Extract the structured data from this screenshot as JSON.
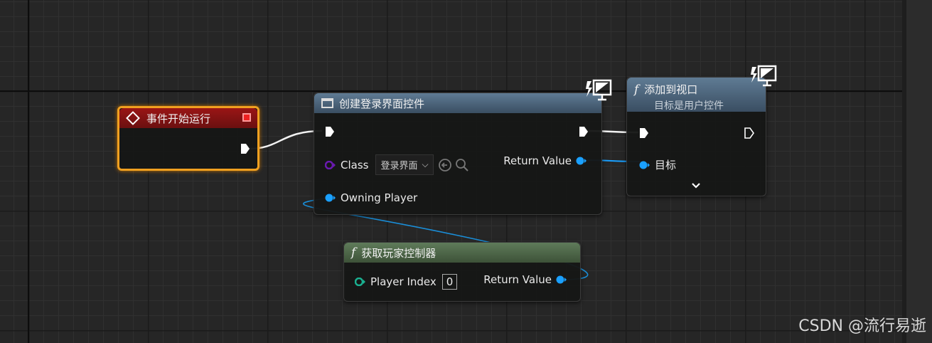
{
  "nodes": {
    "event_begin": {
      "title": "事件开始运行"
    },
    "create_widget": {
      "title": "创建登录界面控件",
      "class_label": "Class",
      "class_value": "登录界面",
      "owning_player_label": "Owning Player",
      "return_value_label": "Return Value"
    },
    "add_to_viewport": {
      "title": "添加到视口",
      "subtitle": "目标是用户控件",
      "target_label": "目标"
    },
    "get_player_controller": {
      "title": "获取玩家控制器",
      "player_index_label": "Player Index",
      "player_index_value": "0",
      "return_value_label": "Return Value"
    }
  },
  "icons": {
    "event": "diamond-event-icon",
    "widget": "widget-icon",
    "function": "function-icon",
    "runtime": "authority-monitor-icon"
  },
  "colors": {
    "event_header": "#8a1414",
    "event_border": "#f0a020",
    "function_header": "#4a6580",
    "pure_header": "#4e6a48",
    "object_pin": "#1aa0ff",
    "class_pin": "#6a1ab0",
    "int_pin": "#1ab090"
  },
  "watermark": "CSDN @流行易逝"
}
